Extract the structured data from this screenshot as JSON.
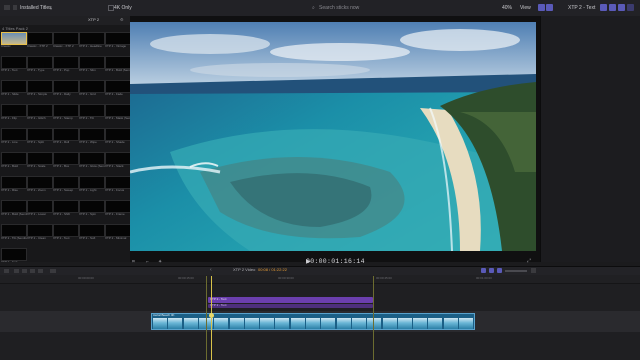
{
  "topbar": {
    "library_label": "Installed Titles",
    "filter_label": "4K Only",
    "search_placeholder": "Search sticks now",
    "zoom": "40%",
    "view_label": "View",
    "inspector_title": "XTP 2 - Text"
  },
  "browser": {
    "tab_label": "XTP 2",
    "group_label": "4 Titles Pack 2",
    "tiles": [
      "Classic",
      "Classic - XTP 2",
      "Classic - XTP 2",
      "XTP 2 - Headline",
      "XTP 2 - Vintage",
      "XTP 2 - Text",
      "XTP 2 - Type",
      "XTP 2 - Pop",
      "XTP 2 - Slim",
      "XTP 2 - Bold (Semibold)",
      "XTP 2 - Slide",
      "XTP 2 - Simple",
      "XTP 2 - Daily",
      "XTP 2 - Grid",
      "XTP 2 - Fade",
      "XTP 2 - Flip",
      "XTP 2 - Glitch",
      "XTP 2 - Stamp",
      "XTP 2 - Tilt",
      "XTP 2 - Mask (Semibold)",
      "XTP 2 - Line",
      "XTP 2 - Split",
      "XTP 2 - Roll",
      "XTP 2 - Wipe",
      "XTP 2 - Shade",
      "XTP 2 - Bold",
      "XTP 2 - Scale",
      "XTP 2 - Box",
      "XTP 2 - Glow (Semibold)",
      "XTP 2 - Stack",
      "XTP 2 - Rise",
      "XTP 2 - Zoom",
      "XTP 2 - Sweep",
      "XTP 2 - Light",
      "XTP 2 - Focus",
      "XTP 2 - Bold (Semibold)",
      "XTP 2 - Lower",
      "XTP 2 - Shift",
      "XTP 2 - Spin",
      "XTP 2 - Frame",
      "XTP 2 - Tilt (Semibold)",
      "XTP 2 - Clean",
      "XTP 2 - Text",
      "XTP 2 - Soft",
      "XTP 2 - Minimal",
      "XTP 2 - End"
    ]
  },
  "viewer": {
    "timecode": "00:00:01:16:14"
  },
  "timeline": {
    "project_name": "XTP 2 Video",
    "duration": "00:08 / 01:22:22",
    "ruler": [
      "00:00:00:00",
      "00:00:15:00",
      "00:00:30:00",
      "00:00:45:00",
      "00:01:00:00"
    ],
    "title_clip_label": "XTP 2 - Text",
    "title_clip_label_2": "XTP 2 - Text",
    "video_clip_label": "Aerial Beach 4K"
  },
  "colors": {
    "accent": "#5a5ab8",
    "title_clip": "#6b3fae",
    "video_clip": "#1b5f86",
    "playhead": "#d8c24a",
    "timecode_orange": "#e39a35"
  }
}
